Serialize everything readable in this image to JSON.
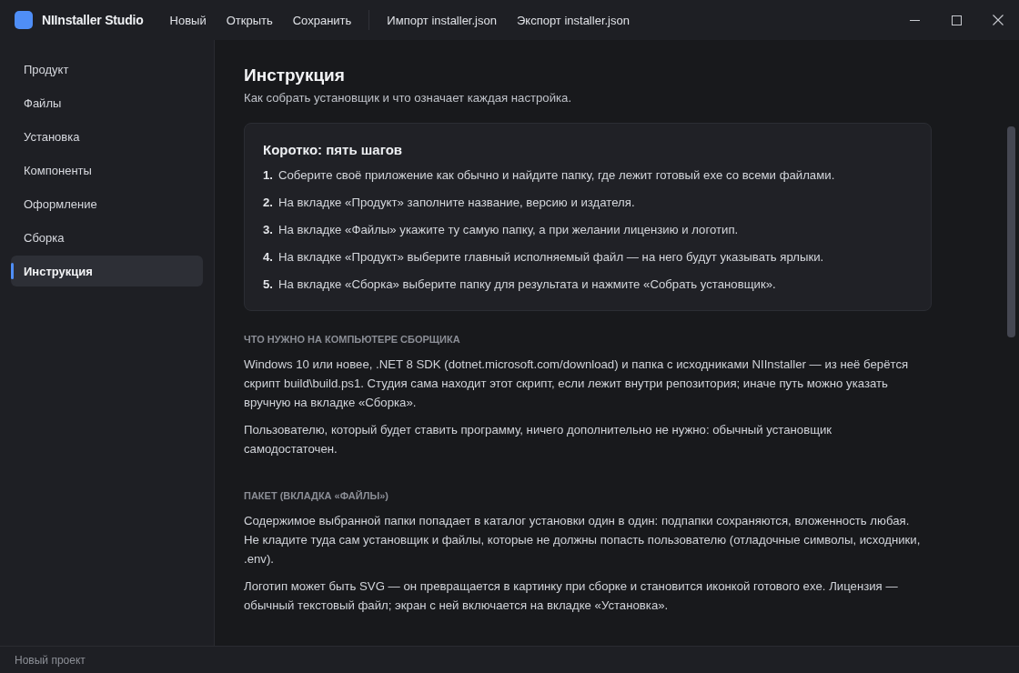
{
  "window": {
    "title": "NIInstaller Studio"
  },
  "menu_groups": [
    [
      "Новый",
      "Открыть",
      "Сохранить"
    ],
    [
      "Импорт installer.json",
      "Экспорт installer.json"
    ]
  ],
  "sidebar": {
    "items": [
      {
        "label": "Продукт",
        "selected": false
      },
      {
        "label": "Файлы",
        "selected": false
      },
      {
        "label": "Установка",
        "selected": false
      },
      {
        "label": "Компоненты",
        "selected": false
      },
      {
        "label": "Оформление",
        "selected": false
      },
      {
        "label": "Сборка",
        "selected": false
      },
      {
        "label": "Инструкция",
        "selected": true
      }
    ]
  },
  "page": {
    "title": "Инструкция",
    "subtitle": "Как собрать установщик и что означает каждая настройка.",
    "card": {
      "title": "Коротко: пять шагов",
      "steps": [
        {
          "number": "1.",
          "text": "Соберите своё приложение как обычно и найдите папку, где лежит готовый exe со всеми файлами."
        },
        {
          "number": "2.",
          "text": "На вкладке «Продукт» заполните название, версию и издателя."
        },
        {
          "number": "3.",
          "text": "На вкладке «Файлы» укажите ту самую папку, а при желании лицензию и логотип."
        },
        {
          "number": "4.",
          "text": "На вкладке «Продукт» выберите главный исполняемый файл — на него будут указывать ярлыки."
        },
        {
          "number": "5.",
          "text": "На вкладке «Сборка» выберите папку для результата и нажмите «Собрать установщик»."
        }
      ]
    },
    "sections": [
      {
        "heading": "ЧТО НУЖНО НА КОМПЬЮТЕРЕ СБОРЩИКА",
        "paragraphs": [
          "Windows 10 или новее, .NET 8 SDK (dotnet.microsoft.com/download) и папка с исходниками NIInstaller — из неё берётся скрипт build\\build.ps1. Студия сама находит этот скрипт, если лежит внутри репозитория; иначе путь можно указать вручную на вкладке «Сборка».",
          "Пользователю, который будет ставить программу, ничего дополнительно не нужно: обычный установщик самодостаточен."
        ]
      },
      {
        "heading": "ПАКЕТ (ВКЛАДКА «ФАЙЛЫ»)",
        "paragraphs": [
          "Содержимое выбранной папки попадает в каталог установки один в один: подпапки сохраняются, вложенность любая. Не кладите туда сам установщик и файлы, которые не должны попасть пользователю (отладочные символы, исходники, .env).",
          "Логотип может быть SVG — он превращается в картинку при сборке и становится иконкой готового exe. Лицензия — обычный текстовый файл; экран с ней включается на вкладке «Установка»."
        ]
      }
    ]
  },
  "status_bar": {
    "text": "Новый проект"
  }
}
